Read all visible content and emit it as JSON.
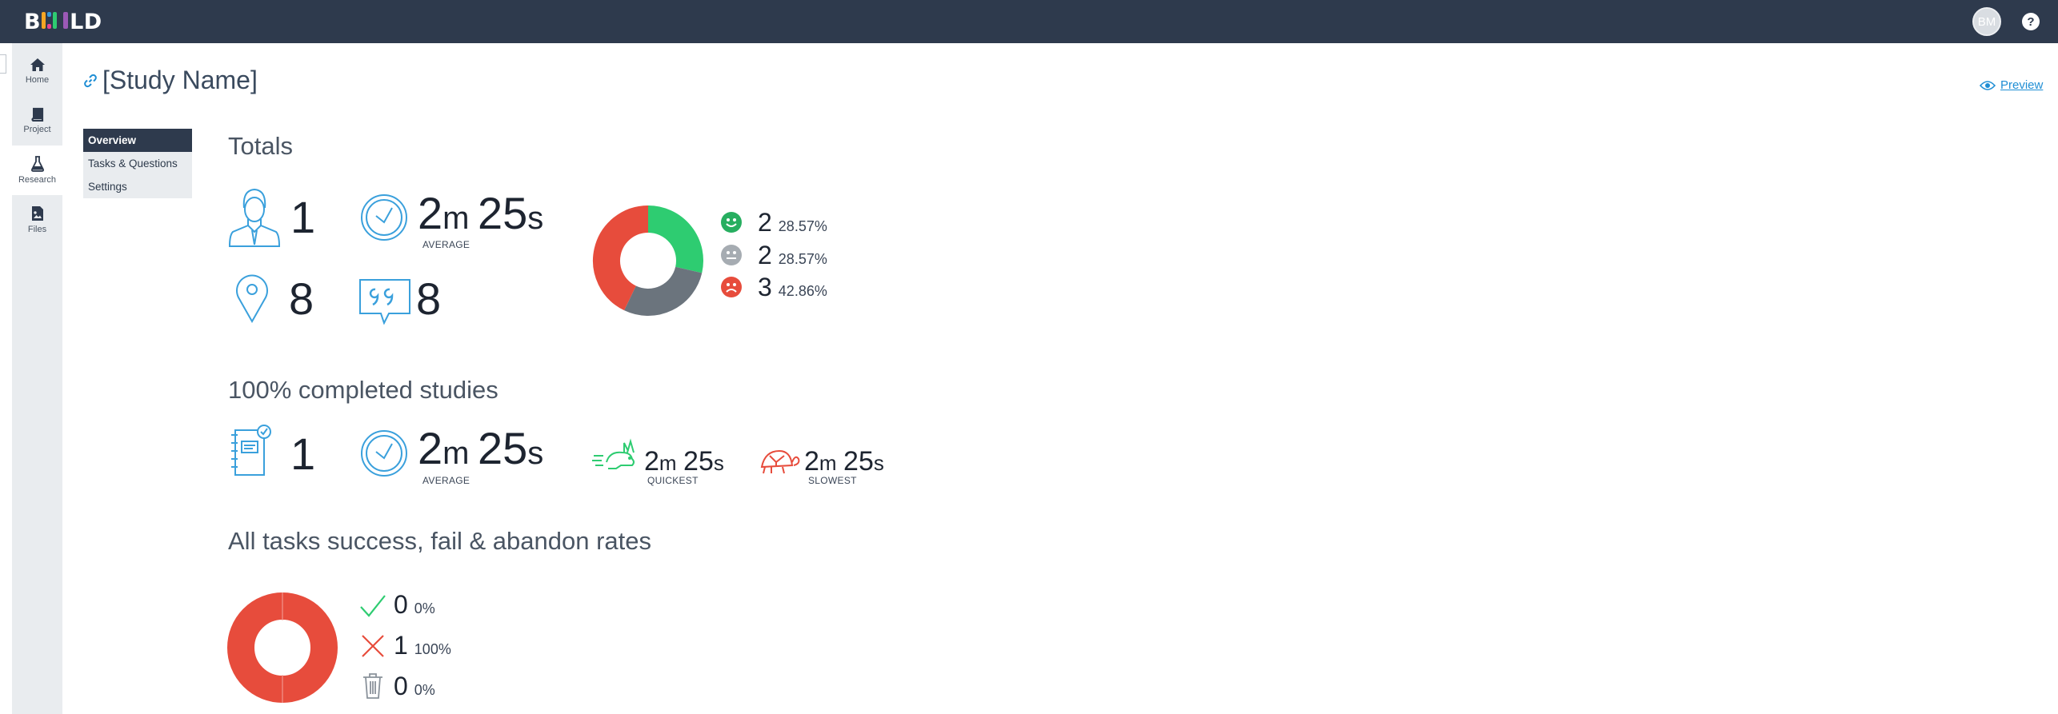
{
  "app": {
    "logo_text_b": "B",
    "logo_text_rest": "LD",
    "avatar_initials": "BM",
    "help_label": "?"
  },
  "rail": [
    {
      "label": "Home",
      "icon": "home-icon"
    },
    {
      "label": "Project",
      "icon": "book-icon"
    },
    {
      "label": "Research",
      "icon": "flask-icon"
    },
    {
      "label": "Files",
      "icon": "image-file-icon"
    }
  ],
  "header": {
    "title": "[Study Name]",
    "preview_label": "Preview"
  },
  "subnav": [
    "Overview",
    "Tasks & Questions",
    "Settings"
  ],
  "totals": {
    "heading": "Totals",
    "participants": "1",
    "locations": "8",
    "comments": "8",
    "avg_time": {
      "min": "2",
      "min_unit": "m",
      "sec": "25",
      "sec_unit": "s",
      "caption": "AVERAGE"
    },
    "sentiment": [
      {
        "count": "2",
        "pct": "28.57%",
        "color": "#2ecc71",
        "icon": "happy-face-icon"
      },
      {
        "count": "2",
        "pct": "28.57%",
        "color": "#9aa1a8",
        "icon": "neutral-face-icon"
      },
      {
        "count": "3",
        "pct": "42.86%",
        "color": "#e74c3c",
        "icon": "sad-face-icon"
      }
    ]
  },
  "completed": {
    "heading": "100% completed studies",
    "count": "1",
    "avg": {
      "min": "2",
      "min_unit": "m",
      "sec": "25",
      "sec_unit": "s",
      "caption": "AVERAGE"
    },
    "quickest": {
      "min": "2",
      "min_unit": "m",
      "sec": "25",
      "sec_unit": "s",
      "caption": "QUICKEST"
    },
    "slowest": {
      "min": "2",
      "min_unit": "m",
      "sec": "25",
      "sec_unit": "s",
      "caption": "SLOWEST"
    }
  },
  "tasks": {
    "heading": "All tasks success, fail & abandon rates",
    "rows": [
      {
        "count": "0",
        "pct": "0%",
        "icon": "check-icon",
        "color": "#2ecc71"
      },
      {
        "count": "1",
        "pct": "100%",
        "icon": "cross-icon",
        "color": "#e74c3c"
      },
      {
        "count": "0",
        "pct": "0%",
        "icon": "trash-icon",
        "color": "#8a929b"
      }
    ]
  },
  "colors": {
    "accent": "#1f8ed4",
    "topbar": "#2e3a4d",
    "green": "#2ecc71",
    "gray": "#6b747d",
    "red": "#e74c3c"
  }
}
